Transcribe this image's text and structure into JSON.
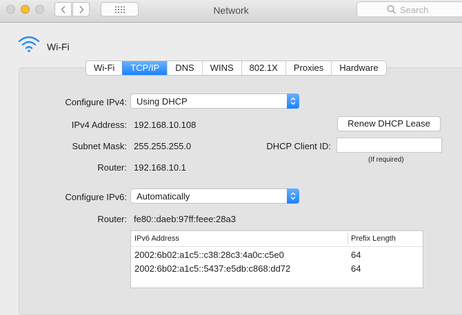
{
  "window": {
    "title": "Network",
    "search_placeholder": "Search"
  },
  "interface": {
    "name": "Wi-Fi",
    "icon": "wifi-icon"
  },
  "tabs": [
    {
      "label": "Wi-Fi",
      "active": false
    },
    {
      "label": "TCP/IP",
      "active": true
    },
    {
      "label": "DNS",
      "active": false
    },
    {
      "label": "WINS",
      "active": false
    },
    {
      "label": "802.1X",
      "active": false
    },
    {
      "label": "Proxies",
      "active": false
    },
    {
      "label": "Hardware",
      "active": false
    }
  ],
  "ipv4": {
    "configure_label": "Configure IPv4:",
    "configure_value": "Using DHCP",
    "address_label": "IPv4 Address:",
    "address_value": "192.168.10.108",
    "subnet_label": "Subnet Mask:",
    "subnet_value": "255.255.255.0",
    "router_label": "Router:",
    "router_value": "192.168.10.1",
    "renew_button": "Renew DHCP Lease",
    "client_id_label": "DHCP Client ID:",
    "client_id_value": "",
    "client_id_note": "(If required)"
  },
  "ipv6": {
    "configure_label": "Configure IPv6:",
    "configure_value": "Automatically",
    "router_label": "Router:",
    "router_value": "fe80::daeb:97ff:feee:28a3",
    "table": {
      "columns": [
        "IPv6 Address",
        "Prefix Length"
      ],
      "rows": [
        [
          "2002:6b02:a1c5::c38:28c3:4a0c:c5e0",
          "64"
        ],
        [
          "2002:6b02:a1c5::5437:e5db:c868:dd72",
          "64"
        ]
      ]
    }
  },
  "colors": {
    "accent": "#1a82fb",
    "window_bg": "#ececec"
  }
}
